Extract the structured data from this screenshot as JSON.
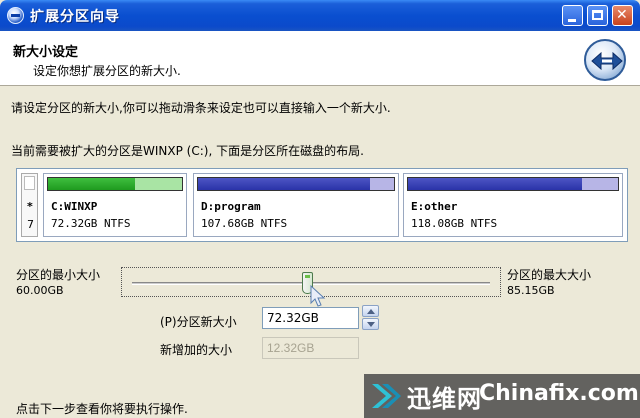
{
  "window": {
    "title": "扩展分区向导",
    "controls": {
      "minimize": "minimize-icon",
      "maximize": "maximize-icon",
      "close": "close-icon"
    }
  },
  "header": {
    "title": "新大小设定",
    "subtitle": "设定你想扩展分区的新大小."
  },
  "body": {
    "instruction": "请设定分区的新大小,你可以拖动滑条来设定也可以直接输入一个新大小.",
    "layout_desc": "当前需要被扩大的分区是WINXP (C:), 下面是分区所在磁盘的布局."
  },
  "disk": {
    "label_symbol": "*",
    "label_number": "7",
    "partitions": [
      {
        "name": "C:WINXP",
        "size": "72.32GB NTFS",
        "color": "#2aa52a",
        "fill": 0.65
      },
      {
        "name": "D:program",
        "size": "107.68GB NTFS",
        "color": "#2f37ad",
        "fill": 0.88
      },
      {
        "name": "E:other",
        "size": "118.08GB NTFS",
        "color": "#2f37ad",
        "fill": 0.83
      }
    ]
  },
  "slider": {
    "min_label": "分区的最小大小",
    "min_value": "60.00GB",
    "max_label": "分区的最大大小",
    "max_value": "85.15GB",
    "position": 0.49
  },
  "fields": {
    "new_size_label": "(P)分区新大小",
    "new_size_value": "72.32GB",
    "added_label": "新增加的大小",
    "added_value": "12.32GB"
  },
  "footer": {
    "text": "点击下一步查看你将要执行操作."
  },
  "watermark": {
    "cn": "迅维网",
    "en": "Chinafix.com"
  }
}
